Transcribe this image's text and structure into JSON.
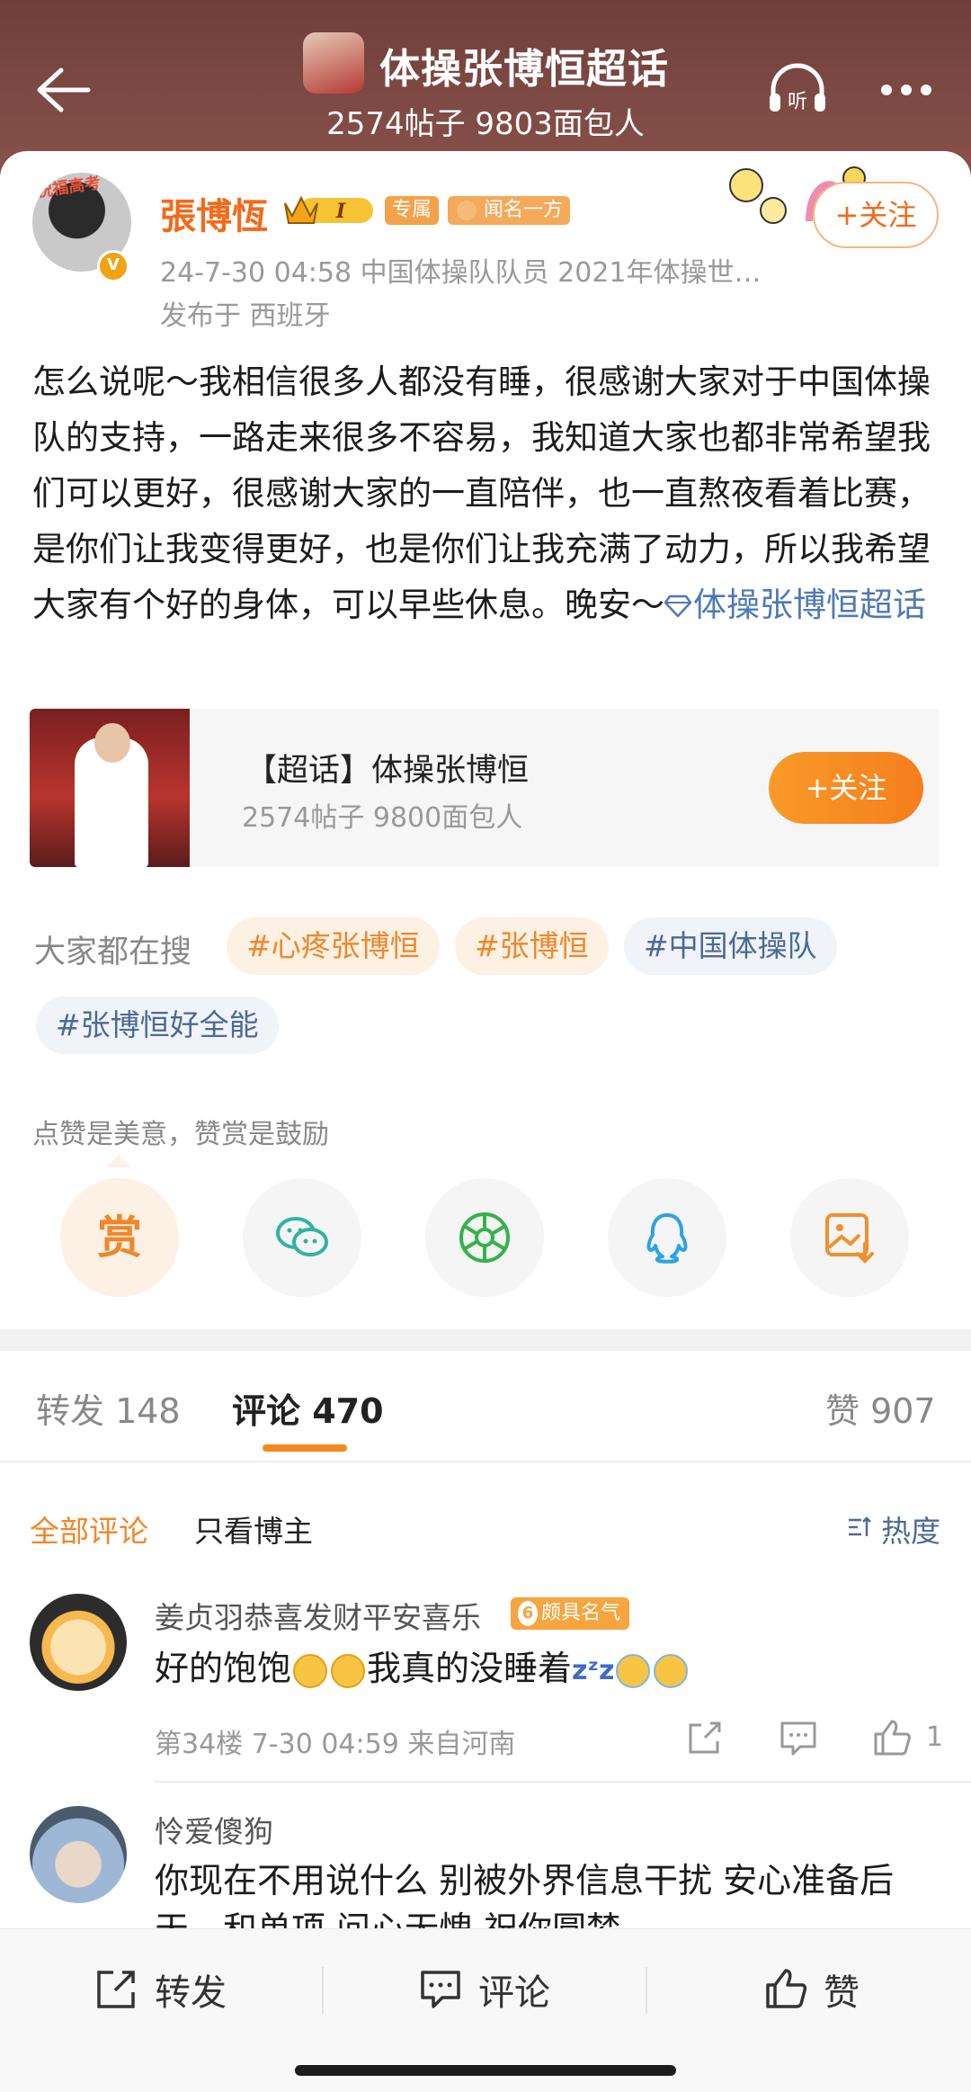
{
  "header": {
    "title": "体操张博恒超话",
    "stats": "2574帖子 9803面包人"
  },
  "post": {
    "author": "張博恆",
    "avatar_tag": "祝福高考",
    "level": "I",
    "badge_exclusive": "专属",
    "badge_fame": "闻名一方",
    "follow_label": "+关注",
    "time_desc": "24-7-30 04:58  中国体操队队员 2021年体操世…",
    "location": "发布于 西班牙",
    "body": "怎么说呢～我相信很多人都没有睡，很感谢大家对于中国体操队的支持，一路走来很多不容易，我知道大家也都非常希望我们可以更好，很感谢大家的一直陪伴，也一直熬夜看着比赛，是你们让我变得更好，也是你们让我充满了动力，所以我希望大家有个好的身体，可以早些休息。晚安～",
    "topic_link": "体操张博恒超话"
  },
  "topic_card": {
    "title": "【超话】体操张博恒",
    "stats": "2574帖子 9800面包人",
    "follow_label": "+关注"
  },
  "search": {
    "label": "大家都在搜",
    "chips": [
      "#心疼张博恒",
      "#张博恒",
      "#中国体操队",
      "#张博恒好全能"
    ]
  },
  "share": {
    "tip": "点赞是美意，赞赏是鼓励",
    "reward_label": "赏"
  },
  "tabs": {
    "repost": "转发 148",
    "comment": "评论 470",
    "like": "赞 907"
  },
  "filters": {
    "all": "全部评论",
    "host_only": "只看博主",
    "sort": "热度"
  },
  "comments": [
    {
      "user": "姜贞羽恭喜发财平安喜乐",
      "badge_level": "6",
      "badge": "颇具名气",
      "text_a": "好的饱饱",
      "text_b": "我真的没睡着",
      "meta": "第34楼  7-30 04:59  来自河南",
      "likes": "1"
    },
    {
      "user": "怜爱傻狗",
      "text": "你现在不用说什么 别被外界信息干扰 安心准备后天…和单项 问心无愧 祝你圆梦"
    }
  ],
  "bottom_bar": {
    "repost": "转发",
    "comment": "评论",
    "like": "赞"
  },
  "colors": {
    "header_bg": "#7a4641",
    "accent_orange": "#f5891f",
    "link_blue": "#4f79b6"
  }
}
